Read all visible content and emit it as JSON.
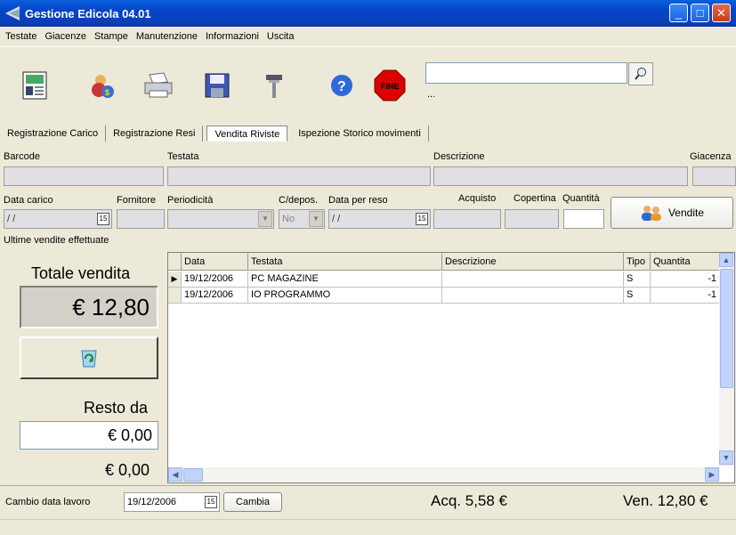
{
  "window": {
    "title": "Gestione Edicola 04.01"
  },
  "menu": [
    "Testate",
    "Giacenze",
    "Stampe",
    "Manutenzione",
    "Informazioni",
    "Uscita"
  ],
  "toolbar": {
    "search_value": "",
    "dots": "...",
    "fine_label": "FINE"
  },
  "tabs": [
    "Registrazione Carico",
    "Registrazione Resi",
    "Vendita Riviste",
    "Ispezione Storico movimenti"
  ],
  "fields_row1": {
    "barcode": "Barcode",
    "testata": "Testata",
    "descrizione": "Descrizione",
    "giacenza": "Giacenza"
  },
  "fields_row2": {
    "data_carico": "Data carico",
    "fornitore": "Fornitore",
    "periodicita": "Periodicità",
    "cdepos": "C/depos.",
    "data_reso": "Data per reso",
    "acquisto": "Acquisto",
    "copertina": "Copertina",
    "quantita": "Quantità",
    "data_carico_val": "/ /",
    "cdepos_val": "No",
    "data_reso_val": "/ /",
    "cal_icon": "15"
  },
  "vendite_button": "Vendite",
  "ultime_label": "Ultime vendite effettuate",
  "left": {
    "totale_label": "Totale vendita",
    "totale_value": "€ 12,80",
    "resto_label": "Resto da",
    "resto_value": "€ 0,00",
    "bottom_value": "€ 0,00"
  },
  "grid": {
    "headers": [
      "Data",
      "Testata",
      "Descrizione",
      "Tipo",
      "Quantita"
    ],
    "rows": [
      {
        "data": "19/12/2006",
        "testata": "PC MAGAZINE",
        "descrizione": "",
        "tipo": "S",
        "quantita": "-1"
      },
      {
        "data": "19/12/2006",
        "testata": "IO PROGRAMMO",
        "descrizione": "",
        "tipo": "S",
        "quantita": "-1"
      }
    ]
  },
  "status": {
    "cambio_label": "Cambio data lavoro",
    "date_value": "19/12/2006",
    "cambia_button": "Cambia",
    "acq": "Acq. 5,58 €",
    "ven": "Ven. 12,80 €"
  }
}
